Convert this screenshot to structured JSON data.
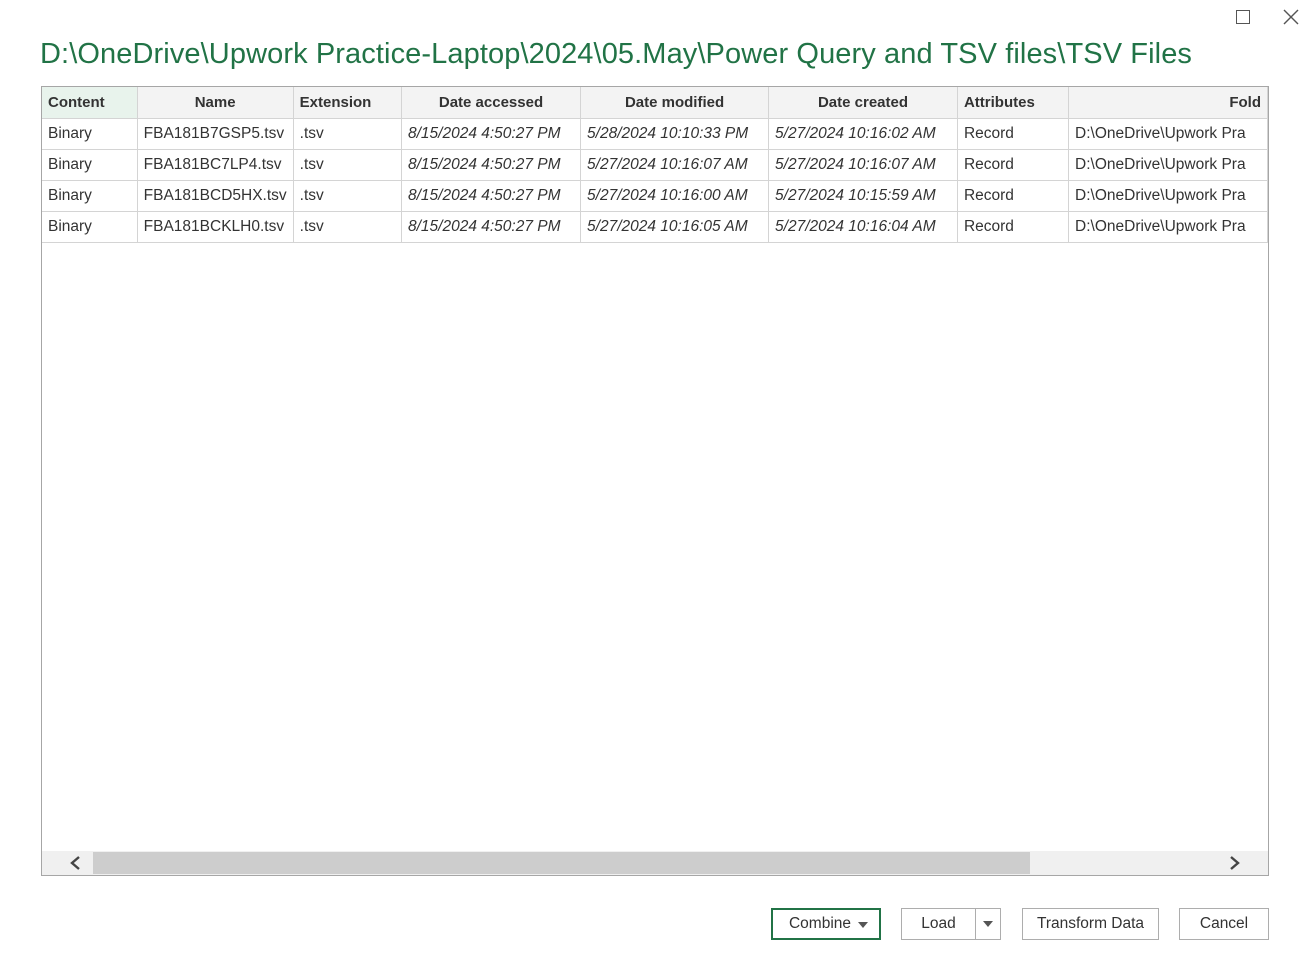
{
  "window": {
    "maximize_glyph": "",
    "close_glyph": "✕"
  },
  "title": "D:\\OneDrive\\Upwork Practice-Laptop\\2024\\05.May\\Power Query and TSV files\\TSV Files",
  "table": {
    "columns": [
      "Content",
      "Name",
      "Extension",
      "Date accessed",
      "Date modified",
      "Date created",
      "Attributes",
      "Fold"
    ],
    "rows": [
      [
        "Binary",
        "FBA181B7GSP5.tsv",
        ".tsv",
        "8/15/2024 4:50:27 PM",
        "5/28/2024 10:10:33 PM",
        "5/27/2024 10:16:02 AM",
        "Record",
        "D:\\OneDrive\\Upwork Pra"
      ],
      [
        "Binary",
        "FBA181BC7LP4.tsv",
        ".tsv",
        "8/15/2024 4:50:27 PM",
        "5/27/2024 10:16:07 AM",
        "5/27/2024 10:16:07 AM",
        "Record",
        "D:\\OneDrive\\Upwork Pra"
      ],
      [
        "Binary",
        "FBA181BCD5HX.tsv",
        ".tsv",
        "8/15/2024 4:50:27 PM",
        "5/27/2024 10:16:00 AM",
        "5/27/2024 10:15:59 AM",
        "Record",
        "D:\\OneDrive\\Upwork Pra"
      ],
      [
        "Binary",
        "FBA181BCKLH0.tsv",
        ".tsv",
        "8/15/2024 4:50:27 PM",
        "5/27/2024 10:16:05 AM",
        "5/27/2024 10:16:04 AM",
        "Record",
        "D:\\OneDrive\\Upwork Pra"
      ]
    ]
  },
  "scrollbar": {
    "left_arrow": "‹",
    "right_arrow": "›"
  },
  "buttons": {
    "combine": "Combine",
    "load": "Load",
    "transform": "Transform Data",
    "cancel": "Cancel"
  },
  "colors": {
    "accent": "#217346"
  }
}
